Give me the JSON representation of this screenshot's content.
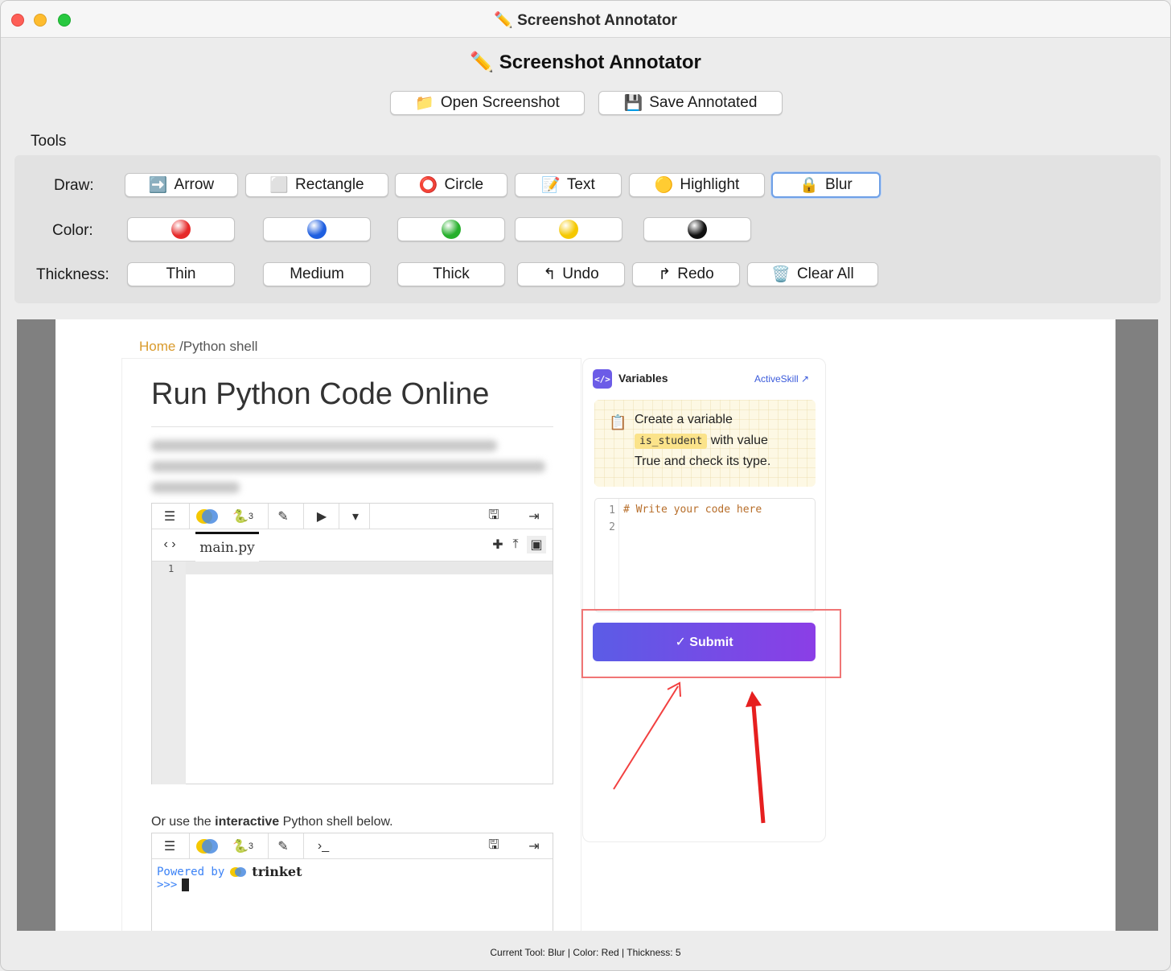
{
  "window": {
    "title": "Screenshot Annotator",
    "title_icon": "✏️"
  },
  "app": {
    "title": "Screenshot Annotator",
    "title_icon": "✏️"
  },
  "file_buttons": {
    "open": {
      "icon": "📁",
      "label": "Open Screenshot"
    },
    "save": {
      "icon": "💾",
      "label": "Save Annotated"
    }
  },
  "tools": {
    "section_label": "Tools",
    "draw_label": "Draw:",
    "color_label": "Color:",
    "thickness_label": "Thickness:",
    "draw": [
      {
        "icon": "➡️",
        "label": "Arrow"
      },
      {
        "icon": "⬜",
        "label": "Rectangle"
      },
      {
        "icon": "⭕",
        "label": "Circle"
      },
      {
        "icon": "📝",
        "label": "Text"
      },
      {
        "icon": "🟡",
        "label": "Highlight"
      },
      {
        "icon": "🔒",
        "label": "Blur"
      }
    ],
    "colors": [
      "#e62a2a",
      "#1f5fe0",
      "#27b02c",
      "#f5c800",
      "#111111"
    ],
    "thickness": [
      {
        "icon": "",
        "label": "Thin"
      },
      {
        "icon": "",
        "label": "Medium"
      },
      {
        "icon": "",
        "label": "Thick"
      },
      {
        "icon": "↰",
        "label": "Undo"
      },
      {
        "icon": "↱",
        "label": "Redo"
      },
      {
        "icon": "🗑️",
        "label": "Clear All"
      }
    ]
  },
  "screenshot": {
    "breadcrumb_home": "Home",
    "breadcrumb_rest": " /Python shell",
    "heading": "Run Python Code Online",
    "editor_tab": "main.py",
    "line_number": "1",
    "shell_label_pre": "Or use the ",
    "shell_label_bold": "interactive",
    "shell_label_post": " Python shell below.",
    "powered_by": "Powered by",
    "trinket": "trinket",
    "prompt": ">>>",
    "python_version": "3",
    "panel_title": "Variables",
    "activeskill": "ActiveSkill ↗",
    "task_line1": "Create a variable",
    "task_code": "is_student",
    "task_line2": "with value",
    "task_line3": "True and check its type.",
    "code_comment": "# Write your code here",
    "code_line1": "1",
    "code_line2": "2",
    "submit": "✓  Submit"
  },
  "status": "Current Tool: Blur | Color: Red | Thickness: 5"
}
